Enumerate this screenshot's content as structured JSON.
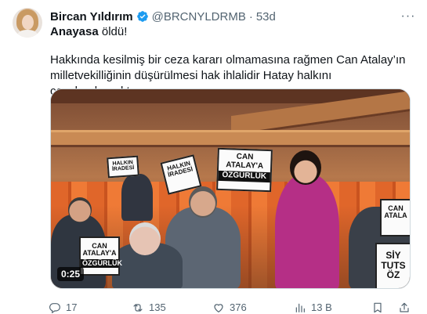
{
  "tweet": {
    "author_name": "Bircan Yıldırım",
    "handle": "@BRCNYLDRMB",
    "separator": "·",
    "time": "53d",
    "more": "···",
    "line1_hashtag": "Anayasa",
    "line1_rest": " öldü!",
    "paragraph": "Hakkında kesilmiş bir ceza kararı olmamasına rağmen Can Atalay’ın milletvekilliğinin düşürülmesi hak ihlalidir Hatay halkını cezalandırmaktır."
  },
  "media": {
    "duration": "0:25",
    "signs": {
      "a_line1": "CAN",
      "a_line2": "ATALAY'A",
      "a_line3": "ÖZGÜRLÜK",
      "b_line1": "HALKIN",
      "b_line2": "İRADESİ",
      "c_line1": "HALKIN",
      "c_line2": "İRADESİ",
      "d_line1": "CAN",
      "d_line2": "ATALAY'A",
      "d_line3": "ÖZGÜRLÜK",
      "e_line1": "CAN",
      "e_line2": "ATALA",
      "f_line1": "SİY",
      "f_line2": "TUTS",
      "f_line3": "ÖZ"
    }
  },
  "actions": {
    "replies": "17",
    "retweets": "135",
    "likes": "376",
    "views": "13 B"
  },
  "colors": {
    "verified": "#1d9bf0",
    "secondary_text": "#536471",
    "accent_magenta": "#b52f86"
  }
}
